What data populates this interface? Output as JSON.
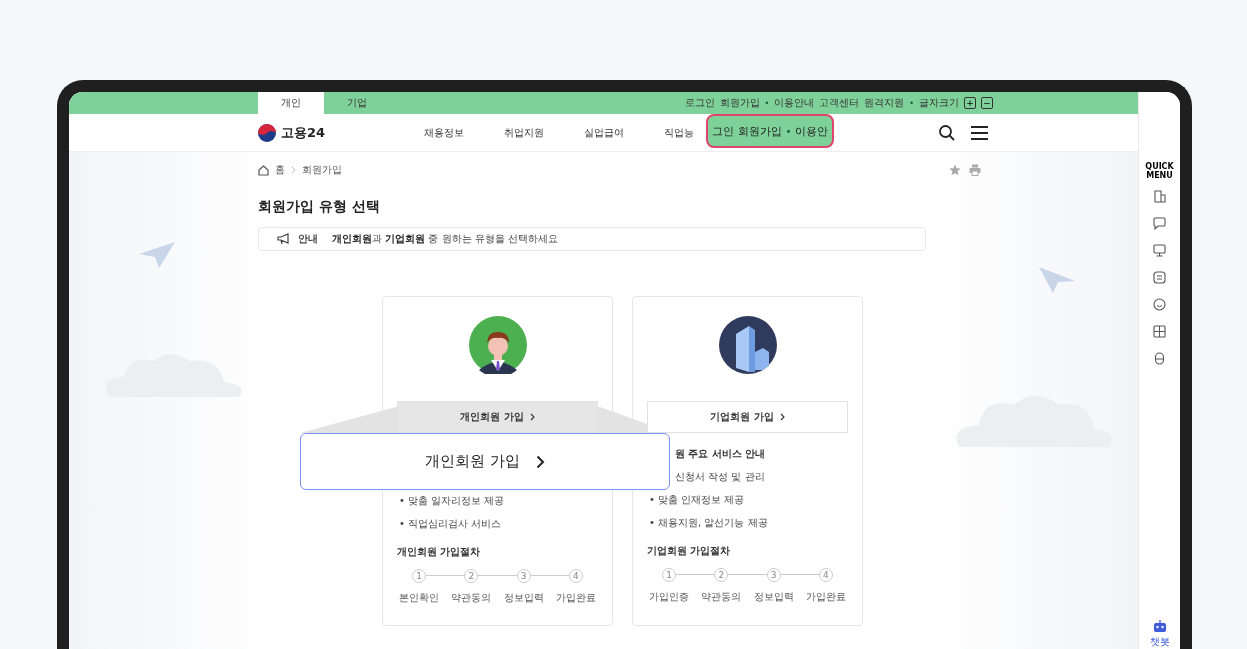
{
  "top_bar": {
    "tabs": [
      {
        "label": "개인",
        "selected": true
      },
      {
        "label": "기업",
        "selected": false
      }
    ],
    "links": [
      {
        "kind": "link",
        "text": "로그인"
      },
      {
        "kind": "link",
        "text": "회원가입"
      },
      {
        "kind": "dot",
        "text": "•"
      },
      {
        "kind": "link",
        "text": "이용안내"
      },
      {
        "kind": "link",
        "text": "고객센터"
      },
      {
        "kind": "link",
        "text": "원격지원"
      },
      {
        "kind": "dot",
        "text": "•"
      },
      {
        "kind": "link",
        "text": "글자크기"
      }
    ],
    "font_buttons": [
      "+",
      "−"
    ]
  },
  "header": {
    "logo": "고용24",
    "nav": [
      "채용정보",
      "취업지원",
      "실업급여",
      "직업능"
    ]
  },
  "magnified_header": {
    "items": [
      {
        "kind": "link",
        "text": "그인"
      },
      {
        "kind": "link",
        "text": "회원가입"
      },
      {
        "kind": "dot",
        "text": "•"
      },
      {
        "kind": "link",
        "text": "이용안"
      }
    ]
  },
  "breadcrumb": [
    "홈",
    "회원가입"
  ],
  "page_title": "회원가입 유형 선택",
  "notice": {
    "label": "안내",
    "text": "**개인회원**과 **기업회원** 중 원하는 유형을 선택하세요"
  },
  "cards": [
    {
      "kind": "person",
      "button": "개인회원 가입",
      "highlighted": true,
      "bullets": [
        "• 맞춤 일자리정보 제공",
        "• 직업심리검사 서비스"
      ],
      "steps_title": "개인회원 가입절차",
      "steps": [
        {
          "number": "1",
          "label": "본인확인"
        },
        {
          "number": "2",
          "label": "약관동의"
        },
        {
          "number": "3",
          "label": "정보입력"
        },
        {
          "number": "4",
          "label": "가입완료"
        }
      ]
    },
    {
      "kind": "company",
      "button": "기업회원 가입",
      "highlighted": false,
      "partial_lines": [
        "원 주요 서비스 안내",
        "신청서 작성 및 관리"
      ],
      "bullets": [
        "• 맞춤 인재정보 제공",
        "• 채용지원, 알선기능 제공"
      ],
      "steps_title": "기업회원 가입절차",
      "steps": [
        {
          "number": "1",
          "label": "가입인증"
        },
        {
          "number": "2",
          "label": "약관동의"
        },
        {
          "number": "3",
          "label": "정보입력"
        },
        {
          "number": "4",
          "label": "가입완료"
        }
      ]
    }
  ],
  "magnified_button": {
    "label": "개인회원 가입"
  },
  "quick_menu": {
    "title": "QUICK MENU",
    "chatbot_label": "챗봇"
  }
}
